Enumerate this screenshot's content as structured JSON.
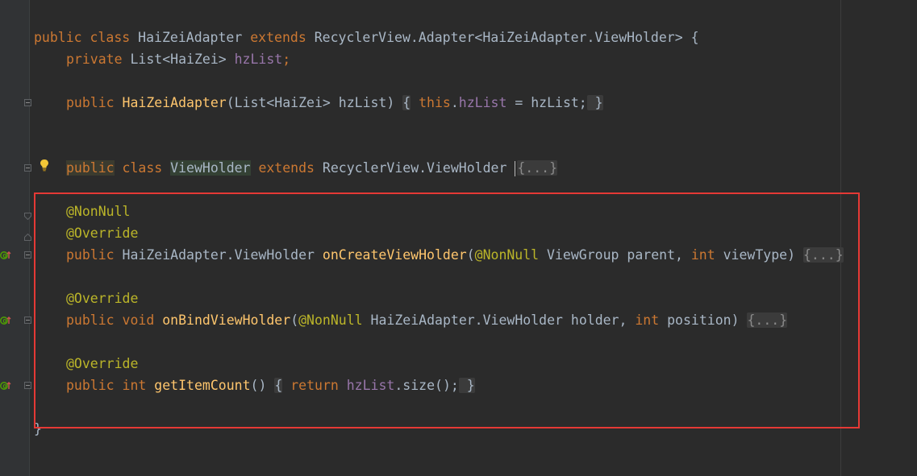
{
  "editor": {
    "language": "java",
    "lines": {
      "class_decl": {
        "t1": "public",
        "t2": " ",
        "t3": "class",
        "t4": " HaiZeiAdapter ",
        "t5": "extends",
        "t6": " RecyclerView.Adapter<HaiZeiAdapter.ViewHolder> {"
      },
      "field_decl": {
        "t1": "private",
        "t2": " List<HaiZei> ",
        "t3": "hzList",
        "t4": ";"
      },
      "constructor": {
        "t1": "public",
        "t2": " ",
        "t3": "HaiZeiAdapter",
        "t4": "(List<HaiZei> hzList) ",
        "t5": "{",
        "t6": " ",
        "t7": "this",
        "t8": ".",
        "t9": "hzList",
        "t10": " = hzList;",
        "t11": " }"
      },
      "viewholder_decl": {
        "t1": "public",
        "t2": " ",
        "t3": "class",
        "t4": " ",
        "t5": "ViewHolder",
        "t6": " ",
        "t7": "extends",
        "t8": " RecyclerView.ViewHolder ",
        "t9": "{...}"
      },
      "annotation_nonnull": "@NonNull",
      "annotation_override_1": "@Override",
      "on_create": {
        "t1": "public",
        "t2": " HaiZeiAdapter.ViewHolder ",
        "t3": "onCreateViewHolder",
        "t4": "(",
        "t5": "@NonNull",
        "t6": " ViewGroup parent, ",
        "t7": "int",
        "t8": " viewType) ",
        "t9": "{...}"
      },
      "annotation_override_2": "@Override",
      "on_bind": {
        "t1": "public",
        "t2": " ",
        "t3": "void",
        "t4": " ",
        "t5": "onBindViewHolder",
        "t6": "(",
        "t7": "@NonNull",
        "t8": " HaiZeiAdapter.ViewHolder holder, ",
        "t9": "int",
        "t10": " position) ",
        "t11": "{...}"
      },
      "annotation_override_3": "@Override",
      "get_count": {
        "t1": "public",
        "t2": " ",
        "t3": "int",
        "t4": " ",
        "t5": "getItemCount",
        "t6": "() ",
        "t7": "{",
        "t8": " ",
        "t9": "return",
        "t10": " ",
        "t11": "hzList",
        "t12": ".size();",
        "t13": " }"
      },
      "closing_brace": "}"
    }
  },
  "colors": {
    "background": "#2b2b2b",
    "keyword": "#cc7832",
    "field": "#9876aa",
    "method": "#ffc66d",
    "annotation": "#bbb529",
    "default_text": "#a9b7c6",
    "highlight_box": "#e53935"
  },
  "icons": {
    "intention_bulb": "lightbulb-icon",
    "override_markers": "override-gutter-icon",
    "fold_markers": "fold-toggle-icon"
  }
}
